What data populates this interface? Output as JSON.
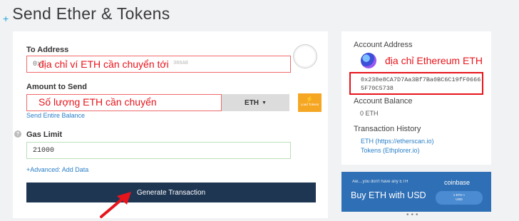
{
  "page": {
    "plus_icon": "+",
    "title": "Send Ether & Tokens"
  },
  "form": {
    "to_address_label": "To Address",
    "to_address_placeholder": "0x…",
    "to_address_ghost": "386A8",
    "to_address_annotation": "địa chỉ ví ETH cần chuyển tới",
    "amount_label": "Amount to Send",
    "amount_annotation": "Số lượng ETH cần chuyển",
    "currency": "ETH",
    "load_tokens": "Load Tokens",
    "send_entire_balance": "Send Entire Balance",
    "gas_limit_label": "Gas Limit",
    "gas_limit_value": "21000",
    "advanced_link": "+Advanced: Add Data",
    "generate_button": "Generate Transaction"
  },
  "account": {
    "address_label": "Account Address",
    "address_annotation": "địa chỉ Ethereum ETH",
    "address": "0x238e8CA7D7Aa3Bf7Ba0BC6C19fF06665F70C5738",
    "balance_label": "Account Balance",
    "balance": "0 ETH",
    "history_label": "Transaction History",
    "history_links": [
      "ETH (https://etherscan.io)",
      "Tokens (Ethplorer.io)"
    ]
  },
  "coinbase_ad": {
    "tagline": "Aw....you don't have any ETH",
    "brand": "coinbase",
    "headline": "Buy ETH with USD",
    "pill_line1": "1 ETH ≈",
    "pill_line2": "USD"
  },
  "colors": {
    "accent": "#21a4d8",
    "annotation": "#e8141b",
    "button": "#1f3653",
    "coinbase": "#2f6fb5"
  }
}
